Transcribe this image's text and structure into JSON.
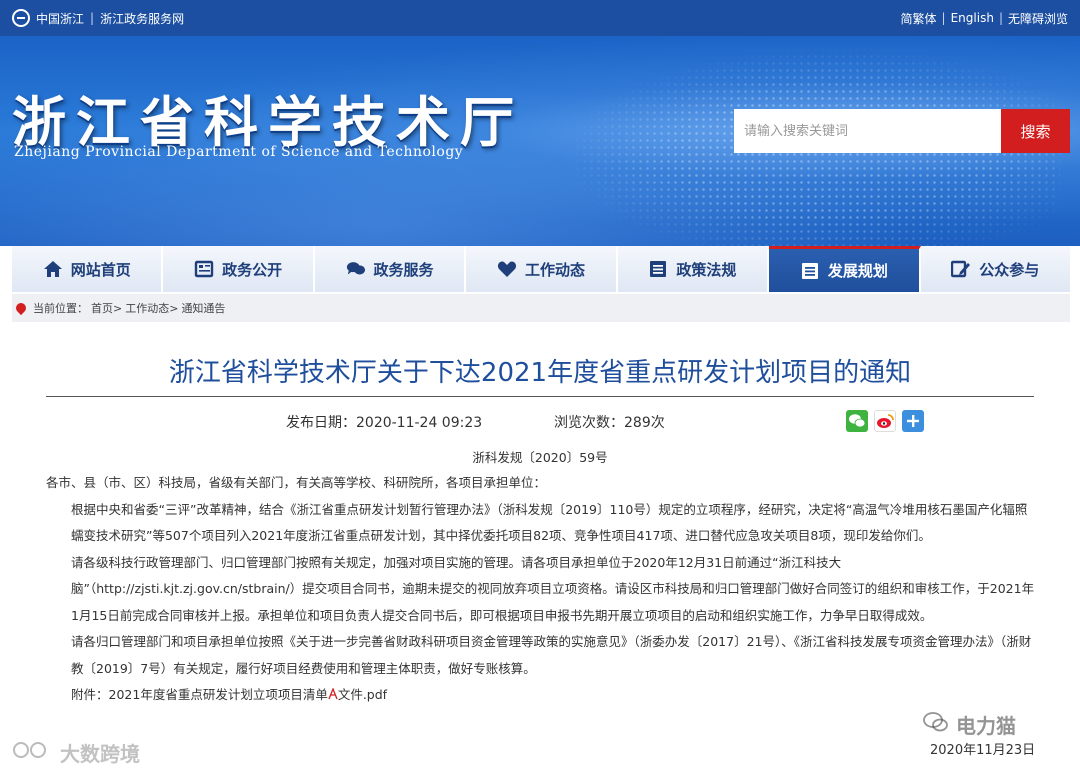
{
  "topbar": {
    "left_links": [
      "中国浙江",
      "浙江政务服务网"
    ],
    "separator": "|",
    "right_links": [
      "简繁体",
      "English",
      "无障碍浏览"
    ]
  },
  "banner": {
    "title_zh": "浙江省科学技术厅",
    "title_en": "Zhejiang Provincial Department of Science and Technology",
    "search_placeholder": "请输入搜索关键词",
    "search_button": "搜索"
  },
  "nav": {
    "items": [
      {
        "label": "网站首页",
        "icon": "home-icon"
      },
      {
        "label": "政务公开",
        "icon": "news-icon"
      },
      {
        "label": "政务服务",
        "icon": "chat-icon"
      },
      {
        "label": "工作动态",
        "icon": "heart-icon"
      },
      {
        "label": "政策法规",
        "icon": "list-icon"
      },
      {
        "label": "发展规划",
        "icon": "document-icon",
        "active": true
      },
      {
        "label": "公众参与",
        "icon": "edit-icon"
      }
    ]
  },
  "breadcrumb": {
    "prefix": "当前位置：",
    "items": [
      "首页>",
      "工作动态>",
      "通知通告"
    ]
  },
  "article": {
    "title": "浙江省科学技术厅关于下达2021年度省重点研发计划项目的通知",
    "publish_date": "发布日期：2020-11-24 09:23",
    "views": "浏览次数：289次",
    "doc_number": "浙科发规〔2020〕59号",
    "paragraphs": [
      "各市、县（市、区）科技局，省级有关部门，有关高等学校、科研院所，各项目承担单位：",
      "根据中央和省委“三评”改革精神，结合《浙江省重点研发计划暂行管理办法》（浙科发规〔2019〕110号）规定的立项程序，经研究，决定将“高温气冷堆用核石墨国产化辐照蠕变技术研究”等507个项目列入2021年度浙江省重点研发计划，其中择优委托项目82项、竞争性项目417项、进口替代应急攻关项目8项，现印发给你们。",
      "请各级科技行政管理部门、归口管理部门按照有关规定，加强对项目实施的管理。请各项目承担单位于2020年12月31日前通过“浙江科技大脑”（http://zjsti.kjt.zj.gov.cn/stbrain/）提交项目合同书，逾期未提交的视同放弃项目立项资格。请设区市科技局和归口管理部门做好合同签订的组织和审核工作，于2021年1月15日前完成合同审核并上报。承担单位和项目负责人提交合同书后，即可根据项目申报书先期开展立项项目的启动和组织实施工作，力争早日取得成效。",
      "请各归口管理部门和项目承担单位按照《关于进一步完善省财政科研项目资金管理等政策的实施意见》（浙委办发〔2017〕21号）、《浙江省科技发展专项资金管理办法》（浙财教〔2019〕7号）有关规定，履行好项目经费使用和管理主体职责，做好专账核算。"
    ],
    "attachment_prefix": "附件：",
    "attachment_name": "2021年度省重点研发计划立项项目清单",
    "attachment_suffix": "文件.pdf"
  },
  "watermarks": {
    "left": "大数跨境",
    "right": "电力猫"
  },
  "date_stamp": "2020年11月23日",
  "colors": {
    "brand_blue": "#1c4fa1",
    "title_blue": "#1f4f9c",
    "accent_red": "#d21e1e"
  }
}
